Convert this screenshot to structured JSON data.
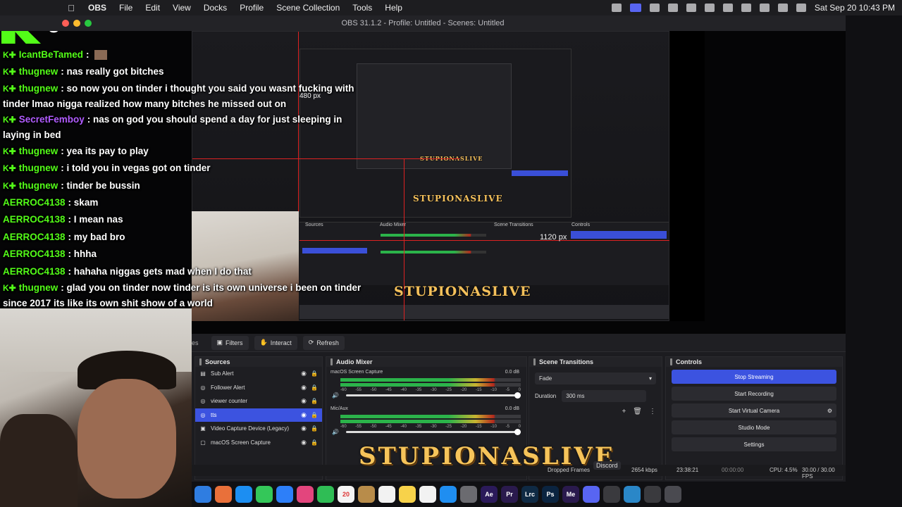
{
  "menubar": {
    "app": "OBS",
    "items": [
      "File",
      "Edit",
      "View",
      "Docks",
      "Profile",
      "Scene Collection",
      "Tools",
      "Help"
    ],
    "clock": "Sat Sep 20  10:43 PM"
  },
  "window": {
    "title": "OBS 31.1.2 - Profile: Untitled - Scenes: Untitled"
  },
  "chat": {
    "badge_count": "5",
    "messages": [
      {
        "user": "IcantBeTamed",
        "text": "",
        "user_color": "#53fc18",
        "badges": true
      },
      {
        "user": "thugnew",
        "text": "nas really got bitches",
        "user_color": "#53fc18",
        "badges": true
      },
      {
        "user": "thugnew",
        "text": "so now you on tinder i thought you said you wasnt fucking with tinder lmao nigga realized how many bitches he missed out on",
        "user_color": "#53fc18",
        "badges": true
      },
      {
        "user": "SecretFemboy",
        "text": "nas on god you should spend a day for just sleeping in laying in bed",
        "user_color": "#b15cff",
        "badges": true
      },
      {
        "user": "thugnew",
        "text": "yea its pay to play",
        "user_color": "#53fc18",
        "badges": true
      },
      {
        "user": "thugnew",
        "text": "i told you in vegas got on tinder",
        "user_color": "#53fc18",
        "badges": true
      },
      {
        "user": "thugnew",
        "text": "tinder be bussin",
        "user_color": "#53fc18",
        "badges": true
      },
      {
        "user": "AERROC4138",
        "text": "skam",
        "user_color": "#53fc18",
        "badges": false
      },
      {
        "user": "AERROC4138",
        "text": "I mean nas",
        "user_color": "#53fc18",
        "badges": false
      },
      {
        "user": "AERROC4138",
        "text": "my bad bro",
        "user_color": "#53fc18",
        "badges": false
      },
      {
        "user": "AERROC4138",
        "text": "hhha",
        "user_color": "#53fc18",
        "badges": false
      },
      {
        "user": "AERROC4138",
        "text": "hahaha niggas gets mad when I do that",
        "user_color": "#53fc18",
        "badges": false
      },
      {
        "user": "thugnew",
        "text": "glad you on tinder now tinder is its own universe i been on tinder since 2017 its like its own shit show of a world",
        "user_color": "#53fc18",
        "badges": true
      }
    ]
  },
  "preview": {
    "label_480": "480 px",
    "label_1120": "1120 px",
    "logo_small": "STUPIONASLIVE"
  },
  "toolbar": {
    "filters": "Filters",
    "interact": "Interact",
    "refresh": "Refresh",
    "partial": "es"
  },
  "sources": {
    "title": "Sources",
    "items": [
      {
        "name": "Sub Alert",
        "icon": "▤",
        "selected": false
      },
      {
        "name": "Follower Alert",
        "icon": "◎",
        "selected": false
      },
      {
        "name": "viewer counter",
        "icon": "◎",
        "selected": false
      },
      {
        "name": "tts",
        "icon": "◎",
        "selected": true
      },
      {
        "name": "Video Capture Device (Legacy)",
        "icon": "▣",
        "selected": false
      },
      {
        "name": "macOS Screen Capture",
        "icon": "▢",
        "selected": false
      }
    ]
  },
  "mixer": {
    "title": "Audio Mixer",
    "channels": [
      {
        "name": "macOS Screen Capture",
        "db": "0.0 dB"
      },
      {
        "name": "Mic/Aux",
        "db": "0.0 dB"
      }
    ],
    "ticks": [
      "-60",
      "-55",
      "-50",
      "-45",
      "-40",
      "-35",
      "-30",
      "-25",
      "-20",
      "-15",
      "-10",
      "-5",
      "0"
    ]
  },
  "transitions": {
    "title": "Scene Transitions",
    "type": "Fade",
    "duration_label": "Duration",
    "duration": "300 ms"
  },
  "controls": {
    "title": "Controls",
    "stop_streaming": "Stop Streaming",
    "start_recording": "Start Recording",
    "start_virtual_camera": "Start Virtual Camera",
    "studio_mode": "Studio Mode",
    "settings": "Settings"
  },
  "status": {
    "dropped": "Dropped Frames",
    "bitrate": "2654 kbps",
    "live_time": "23:38:21",
    "rec_time": "00:00:00",
    "cpu": "CPU: 4.5%",
    "fps": "30.00 / 30.00 FPS"
  },
  "overlay_logo": "STUPIONASLIVE",
  "tooltip": "Discord",
  "dock": {
    "apps": [
      {
        "label": "",
        "color": "#2f7de1"
      },
      {
        "label": "",
        "color": "#e9703a"
      },
      {
        "label": "",
        "color": "#1c8ef2"
      },
      {
        "label": "",
        "color": "#34c759"
      },
      {
        "label": "",
        "color": "#2d7ff9"
      },
      {
        "label": "",
        "color": "#e3457d"
      },
      {
        "label": "",
        "color": "#2fbd55"
      },
      {
        "label": "20",
        "color": "#f4f4f4"
      },
      {
        "label": "",
        "color": "#b88c4a"
      },
      {
        "label": "",
        "color": "#f2f2f2"
      },
      {
        "label": "",
        "color": "#f7d24a"
      },
      {
        "label": "",
        "color": "#f2f2f2"
      },
      {
        "label": "",
        "color": "#1f8ef1"
      },
      {
        "label": "",
        "color": "#6b6b70"
      },
      {
        "label": "Ae",
        "color": "#2b1a5a"
      },
      {
        "label": "Pr",
        "color": "#2a1a4d"
      },
      {
        "label": "Lrc",
        "color": "#0f2a44"
      },
      {
        "label": "Ps",
        "color": "#0b2440"
      },
      {
        "label": "Me",
        "color": "#2a1a4d"
      },
      {
        "label": "",
        "color": "#5865f2"
      },
      {
        "label": "",
        "color": "#3a3a3e"
      },
      {
        "label": "",
        "color": "#2a87c8"
      },
      {
        "label": "",
        "color": "#3a3a3e"
      },
      {
        "label": "",
        "color": "#4a4a50"
      }
    ]
  }
}
